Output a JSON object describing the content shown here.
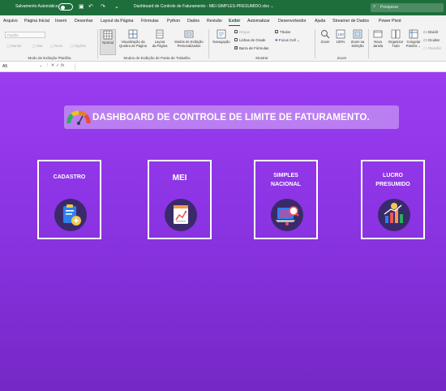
{
  "titlebar": {
    "autosave_label": "Salvamento Automático",
    "file_name": "Dashboard de Controle de Faturamento - MEI-SIMPLES-PRESUMIDO.xlsx ⌄",
    "search_placeholder": "Pesquisar"
  },
  "menu_tabs": [
    {
      "label": "Arquivo"
    },
    {
      "label": "Página Inicial"
    },
    {
      "label": "Inserir"
    },
    {
      "label": "Desenhar"
    },
    {
      "label": "Layout da Página"
    },
    {
      "label": "Fórmulas"
    },
    {
      "label": "Python"
    },
    {
      "label": "Dados"
    },
    {
      "label": "Revisão"
    },
    {
      "label": "Exibir"
    },
    {
      "label": "Automatizar"
    },
    {
      "label": "Desenvolvedor"
    },
    {
      "label": "Ajuda"
    },
    {
      "label": "Streamer de Dados"
    },
    {
      "label": "Power Pivot"
    }
  ],
  "ribbon": {
    "sheet_view": {
      "dropdown": "Padrão",
      "manter": "Manter",
      "sair": "Sair",
      "novo": "Novo",
      "opcoes": "Opções",
      "group_label": "Modo de Exibição Planilha"
    },
    "workbook_views": {
      "normal": "Normal",
      "quebra_1": "Visualização da",
      "quebra_2": "Quebra de Página",
      "layout_1": "Layout",
      "layout_2": "da Página",
      "personal_1": "Modos de Exibição",
      "personal_2": "Personalizados",
      "group_label": "Modos de Exibição de Pasta de Trabalho"
    },
    "show": {
      "navegacao": "Navegação",
      "regua": "Régua",
      "linhas_grade": "Linhas de Grade",
      "barra_formulas": "Barra de Fórmulas",
      "titulos": "Títulos",
      "focus_cell": "Focus Cell",
      "group_label": "Mostrar"
    },
    "zoom": {
      "zoom": "Zoom",
      "pct": "100%",
      "selecao_1": "Zoom na",
      "selecao_2": "Seleção",
      "group_label": "Zoom"
    },
    "window": {
      "nova_1": "Nova",
      "nova_2": "Janela",
      "organizar_1": "Organizar",
      "organizar_2": "Tudo",
      "congelar_1": "Congelar",
      "congelar_2": "Painéis ⌄",
      "dividir": "Dividir",
      "ocultar": "Ocultar",
      "reexibir": "Reexibir"
    }
  },
  "formula_bar": {
    "cell_ref": "A5",
    "fx": "fx"
  },
  "dashboard": {
    "title": "DASHBOARD DE CONTROLE DE LIMITE DE FATURAMENTO.",
    "cards": [
      {
        "label": "CADASTRO",
        "icon": "clipboard-add-icon"
      },
      {
        "label": "MEI",
        "icon": "document-chart-icon"
      },
      {
        "label_line1": "SIMPLES",
        "label_line2": "NACIONAL",
        "icon": "laptop-search-icon"
      },
      {
        "label_line1": "LUCRO",
        "label_line2": "PRESUMIDO",
        "icon": "chart-growth-icon"
      }
    ]
  }
}
